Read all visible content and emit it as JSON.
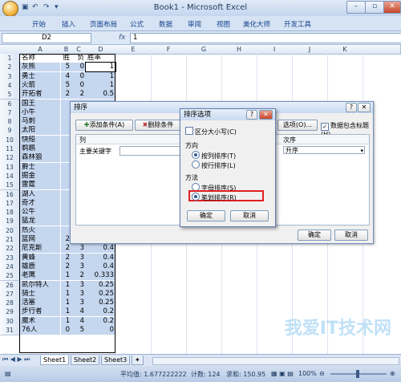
{
  "window": {
    "title": "Book1 - Microsoft Excel"
  },
  "ribbon_tabs": [
    "开始",
    "插入",
    "页面布局",
    "公式",
    "数据",
    "审阅",
    "视图",
    "美化大师",
    "开发工具"
  ],
  "formula_bar": {
    "name_box": "D2",
    "fx": "fx",
    "value": "1"
  },
  "columns": [
    "A",
    "B",
    "C",
    "D",
    "E",
    "F",
    "G",
    "H",
    "I",
    "J",
    "K"
  ],
  "rows": [
    {
      "n": "1",
      "a": "名称",
      "b": "胜",
      "c": "负",
      "d": "胜率"
    },
    {
      "n": "2",
      "a": "灰熊",
      "b": "5",
      "c": "0",
      "d": "1"
    },
    {
      "n": "3",
      "a": "勇士",
      "b": "4",
      "c": "0",
      "d": "1"
    },
    {
      "n": "4",
      "a": "火箭",
      "b": "5",
      "c": "0",
      "d": "1"
    },
    {
      "n": "5",
      "a": "开拓者",
      "b": "2",
      "c": "2",
      "d": "0.5"
    },
    {
      "n": "6",
      "a": "国王",
      "b": "",
      "c": "",
      "d": ""
    },
    {
      "n": "7",
      "a": "小牛",
      "b": "",
      "c": "",
      "d": ""
    },
    {
      "n": "8",
      "a": "马刺",
      "b": "",
      "c": "",
      "d": ""
    },
    {
      "n": "9",
      "a": "太阳",
      "b": "",
      "c": "",
      "d": ""
    },
    {
      "n": "10",
      "a": "快船",
      "b": "",
      "c": "",
      "d": ""
    },
    {
      "n": "11",
      "a": "鹈鹕",
      "b": "",
      "c": "",
      "d": ""
    },
    {
      "n": "12",
      "a": "森林狼",
      "b": "",
      "c": "",
      "d": ""
    },
    {
      "n": "13",
      "a": "爵士",
      "b": "",
      "c": "",
      "d": ""
    },
    {
      "n": "14",
      "a": "掘金",
      "b": "",
      "c": "",
      "d": ""
    },
    {
      "n": "15",
      "a": "雷霆",
      "b": "",
      "c": "",
      "d": ""
    },
    {
      "n": "16",
      "a": "湖人",
      "b": "",
      "c": "",
      "d": ""
    },
    {
      "n": "17",
      "a": "奇才",
      "b": "",
      "c": "",
      "d": ""
    },
    {
      "n": "18",
      "a": "公牛",
      "b": "",
      "c": "",
      "d": ""
    },
    {
      "n": "19",
      "a": "猛龙",
      "b": "",
      "c": "",
      "d": ""
    },
    {
      "n": "20",
      "a": "热火",
      "b": "",
      "c": "",
      "d": ""
    },
    {
      "n": "21",
      "a": "篮网",
      "b": "2",
      "c": "2",
      "d": "0.5"
    },
    {
      "n": "22",
      "a": "尼克斯",
      "b": "2",
      "c": "3",
      "d": "0.4"
    },
    {
      "n": "23",
      "a": "黄蜂",
      "b": "2",
      "c": "3",
      "d": "0.4"
    },
    {
      "n": "24",
      "a": "雄鹿",
      "b": "2",
      "c": "3",
      "d": "0.4"
    },
    {
      "n": "25",
      "a": "老鹰",
      "b": "1",
      "c": "2",
      "d": "0.333"
    },
    {
      "n": "26",
      "a": "凯尔特人",
      "b": "1",
      "c": "3",
      "d": "0.25"
    },
    {
      "n": "27",
      "a": "骑士",
      "b": "1",
      "c": "3",
      "d": "0.25"
    },
    {
      "n": "28",
      "a": "活塞",
      "b": "1",
      "c": "3",
      "d": "0.25"
    },
    {
      "n": "29",
      "a": "步行者",
      "b": "1",
      "c": "4",
      "d": "0.2"
    },
    {
      "n": "30",
      "a": "魔术",
      "b": "1",
      "c": "4",
      "d": "0.2"
    },
    {
      "n": "31",
      "a": "76人",
      "b": "0",
      "c": "5",
      "d": "0"
    }
  ],
  "sort_dialog": {
    "title": "排序",
    "add_label": "添加条件(A)",
    "delete_label": "删除条件",
    "options_label": "选项(O)...",
    "header_checkbox_label": "数据包含标题(H)",
    "col_header": "列",
    "order_header": "次序",
    "primary_key_label": "主要关键字",
    "order_value": "升序",
    "ok_label": "确定",
    "cancel_label": "取消",
    "help": "?"
  },
  "options_dialog": {
    "title": "排序选项",
    "help": "?",
    "case_label": "区分大小写(C)",
    "direction_label": "方向",
    "by_column_label": "按列排序(T)",
    "by_row_label": "按行排序(L)",
    "method_label": "方法",
    "letter_label": "字母排序(S)",
    "stroke_label": "笔划排序(R)",
    "ok_label": "确定",
    "cancel_label": "取消",
    "highlight_color": "#e02020"
  },
  "sheet_tabs": [
    "Sheet1",
    "Sheet2",
    "Sheet3"
  ],
  "status": {
    "average": "平均值: 1.677222222",
    "count": "计数: 124",
    "sum": "求和: 150.95",
    "zoom": "100%"
  },
  "watermark": "我爱IT技术网"
}
